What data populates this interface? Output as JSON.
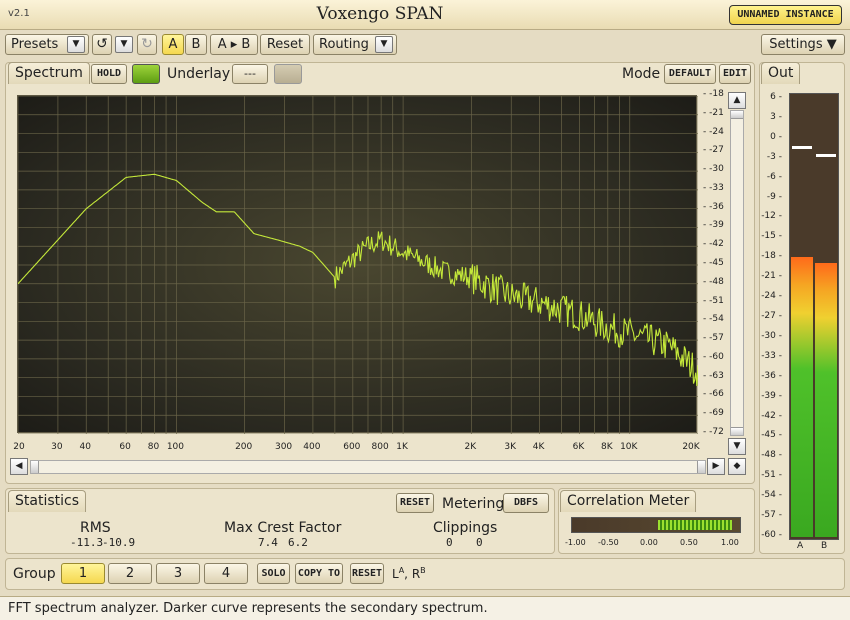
{
  "app": {
    "version": "v2.1",
    "title": "Voxengo SPAN",
    "instance": "UNNAMED INSTANCE"
  },
  "toolbar": {
    "presets": "Presets",
    "a": "A",
    "b": "B",
    "ab": "A ▸ B",
    "reset": "Reset",
    "routing": "Routing",
    "settings": "Settings"
  },
  "spectrum": {
    "tab": "Spectrum",
    "hold": "HOLD",
    "underlay": "Underlay",
    "underlay_value": "---",
    "mode": "Mode",
    "default": "DEFAULT",
    "edit": "EDIT"
  },
  "y_ticks": [
    "-18",
    "-21",
    "-24",
    "-27",
    "-30",
    "-33",
    "-36",
    "-39",
    "-42",
    "-45",
    "-48",
    "-51",
    "-54",
    "-57",
    "-60",
    "-63",
    "-66",
    "-69",
    "-72"
  ],
  "x_ticks": [
    "20",
    "30",
    "40",
    "60",
    "80",
    "100",
    "200",
    "300",
    "400",
    "600",
    "800",
    "1K",
    "2K",
    "3K",
    "4K",
    "6K",
    "8K",
    "10K",
    "20K"
  ],
  "out": {
    "tab": "Out",
    "ticks": [
      "6",
      "3",
      "0",
      "-3",
      "-6",
      "-9",
      "-12",
      "-15",
      "-18",
      "-21",
      "-24",
      "-27",
      "-30",
      "-33",
      "-36",
      "-39",
      "-42",
      "-45",
      "-48",
      "-51",
      "-54",
      "-57",
      "-60"
    ],
    "ch_a": "A",
    "ch_b": "B",
    "level_a": 0.63,
    "level_b": 0.63
  },
  "stats": {
    "tab": "Statistics",
    "reset": "RESET",
    "metering": "Metering",
    "dbfs": "DBFS",
    "rms_label": "RMS",
    "rms_l": "-11.3",
    "rms_r": "-10.9",
    "crest_label": "Max Crest Factor",
    "crest_l": "7.4",
    "crest_r": "6.2",
    "clip_label": "Clippings",
    "clip_l": "0",
    "clip_r": "0"
  },
  "corr": {
    "tab": "Correlation Meter",
    "ticks": [
      "-1.00",
      "-0.50",
      "0.00",
      "0.50",
      "1.00"
    ]
  },
  "group": {
    "label": "Group",
    "g1": "1",
    "g2": "2",
    "g3": "3",
    "g4": "4",
    "solo": "SOLO",
    "copy": "COPY TO",
    "reset": "RESET",
    "ch_l": "L",
    "ch_l_sup": "A",
    "ch_r": "R",
    "ch_r_sup": "B",
    "sep": ","
  },
  "status": "FFT spectrum analyzer. Darker curve represents the secondary spectrum.",
  "colors": {
    "curve": "#c4e83a",
    "accent": "#f5d84f"
  }
}
